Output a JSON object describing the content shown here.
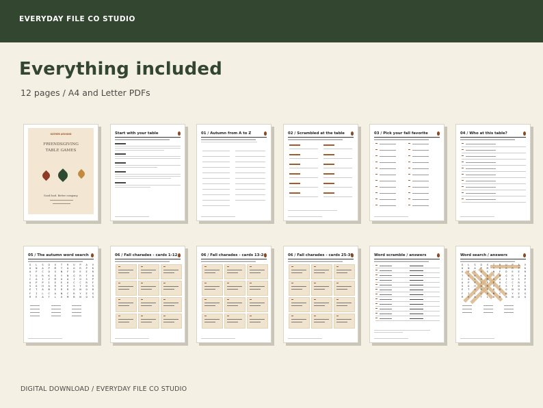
{
  "header": {
    "brand": "EVERYDAY FILE CO STUDIO"
  },
  "hero": {
    "title": "Everything included",
    "subtitle": "12 pages / A4 and Letter PDFs"
  },
  "footer": {
    "text": "DIGITAL DOWNLOAD / EVERYDAY FILE CO STUDIO"
  },
  "cover": {
    "tag": "GATHER AROUND",
    "title_line1": "FRIENDSGIVING",
    "title_line2": "TABLE GAMES",
    "tagline": "Good food. Better company."
  },
  "pages": [
    {
      "title": "Start with your table"
    },
    {
      "title": "01 / Autumn from A to Z"
    },
    {
      "title": "02 / Scrambled at the table"
    },
    {
      "title": "03 / Pick your fall favorite"
    },
    {
      "title": "04 / Who at this table?"
    },
    {
      "title": "05 / The autumn word search"
    },
    {
      "title": "06 / Fall charades - cards 1-12"
    },
    {
      "title": "06 / Fall charades - cards 13-24"
    },
    {
      "title": "06 / Fall charades - cards 25-36"
    },
    {
      "title": "Word scramble / answers"
    },
    {
      "title": "Word search / answers"
    }
  ],
  "colors": {
    "brand_green": "#334630",
    "cream": "#f4f0e4",
    "accent_rust": "#a15a2a"
  }
}
